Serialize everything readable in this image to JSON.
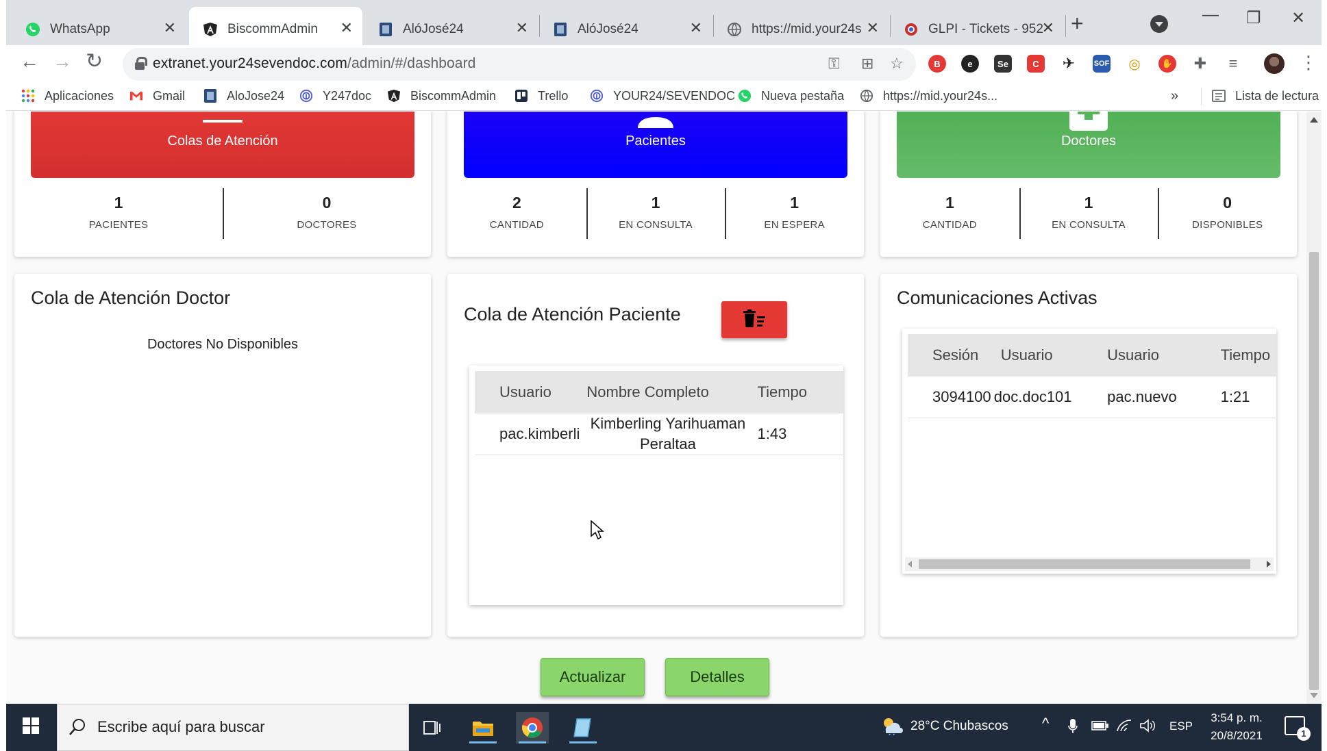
{
  "browser": {
    "tabs": [
      {
        "title": "WhatsApp",
        "icon": "whatsapp-icon"
      },
      {
        "title": "BiscommAdmin",
        "icon": "angular-icon",
        "active": true
      },
      {
        "title": "AlóJosé24",
        "icon": "app-icon"
      },
      {
        "title": "AlóJosé24",
        "icon": "app-icon"
      },
      {
        "title": "https://mid.your24s",
        "icon": "globe-icon"
      },
      {
        "title": "GLPI - Tickets - 952",
        "icon": "glpi-icon"
      }
    ],
    "url_host": "extranet.your24sevendoc.com",
    "url_path": "/admin/#/dashboard",
    "bookmarks": [
      {
        "label": "Aplicaciones",
        "icon": "apps-grid-icon"
      },
      {
        "label": "Gmail",
        "icon": "gmail-icon"
      },
      {
        "label": "AloJose24",
        "icon": "app-icon"
      },
      {
        "label": "Y247doc",
        "icon": "fingerprint-icon"
      },
      {
        "label": "BiscommAdmin",
        "icon": "angular-icon"
      },
      {
        "label": "Trello",
        "icon": "trello-icon"
      },
      {
        "label": "YOUR24/SEVENDOC",
        "icon": "fingerprint-icon"
      },
      {
        "label": "Nueva pestaña",
        "icon": "whatsapp-icon"
      },
      {
        "label": "https://mid.your24s...",
        "icon": "globe-icon"
      }
    ],
    "bookmarks_overflow": "»",
    "reading_list": "Lista de lectura",
    "extensions": [
      "ext-b",
      "ext-e",
      "Se",
      "ext-c",
      "ext-x",
      "SOF",
      "ext-o",
      "ext-stop",
      "puzzle"
    ]
  },
  "dashboard": {
    "stats": [
      {
        "title": "Colas de Atención",
        "color_from": "#e53935",
        "color_to": "#d32f2f",
        "icon": "list-icon",
        "items": [
          {
            "value": "1",
            "label": "PACIENTES"
          },
          {
            "value": "0",
            "label": "DOCTORES"
          }
        ]
      },
      {
        "title": "Pacientes",
        "color_from": "#2200f5",
        "color_to": "#0000ff",
        "icon": "person-icon",
        "items": [
          {
            "value": "2",
            "label": "CANTIDAD"
          },
          {
            "value": "1",
            "label": "EN CONSULTA"
          },
          {
            "value": "1",
            "label": "EN ESPERA"
          }
        ]
      },
      {
        "title": "Doctores",
        "color_from": "#4caf50",
        "color_to": "#66bb6a",
        "icon": "medical-cross-icon",
        "items": [
          {
            "value": "1",
            "label": "CANTIDAD"
          },
          {
            "value": "1",
            "label": "EN CONSULTA"
          },
          {
            "value": "0",
            "label": "DISPONIBLES"
          }
        ]
      }
    ],
    "doctor_queue": {
      "title": "Cola de Atención Doctor",
      "empty": "Doctores No Disponibles"
    },
    "patient_queue": {
      "title": "Cola de Atención Paciente",
      "columns": [
        "Usuario",
        "Nombre Completo",
        "Tiempo"
      ],
      "rows": [
        {
          "usuario": "pac.kimberli",
          "nombre_l1": "Kimberling Yarihuaman",
          "nombre_l2": "Peraltaa",
          "tiempo": "1:43"
        }
      ]
    },
    "communications": {
      "title": "Comunicaciones Activas",
      "columns": [
        "Sesión",
        "Usuario",
        "Usuario",
        "Tiempo"
      ],
      "rows": [
        {
          "sesion": "3094100",
          "usuario1": "doc.doc101",
          "usuario2": "pac.nuevo",
          "tiempo": "1:21"
        }
      ]
    },
    "buttons": {
      "refresh": "Actualizar",
      "details": "Detalles"
    }
  },
  "taskbar": {
    "search_placeholder": "Escribe aquí para buscar",
    "weather": "28°C  Chubascos",
    "language": "ESP",
    "time": "3:54 p. m.",
    "date": "20/8/2021",
    "notifications": "1"
  }
}
